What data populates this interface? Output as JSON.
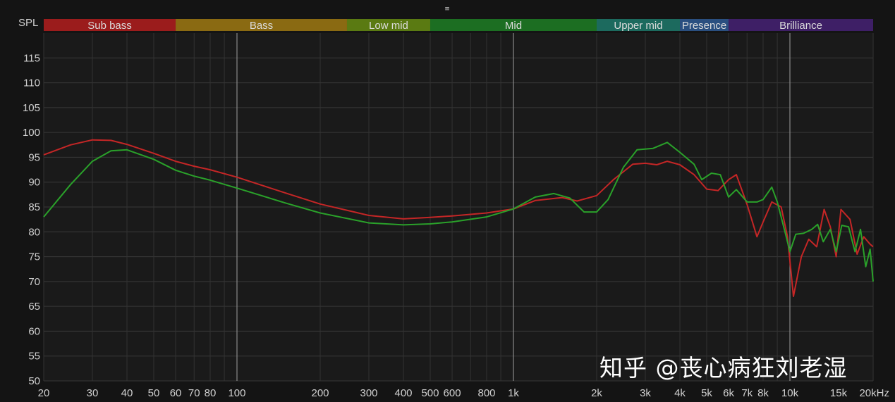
{
  "chart_data": {
    "type": "line",
    "title": "",
    "xlabel": "",
    "ylabel": "SPL",
    "x_scale": "log",
    "xlim": [
      20,
      20000
    ],
    "ylim": [
      50,
      120
    ],
    "y_ticks": [
      50,
      55,
      60,
      65,
      70,
      75,
      80,
      85,
      90,
      95,
      100,
      105,
      110,
      115
    ],
    "x_ticks": [
      {
        "v": 20,
        "label": "20"
      },
      {
        "v": 30,
        "label": "30"
      },
      {
        "v": 40,
        "label": "40"
      },
      {
        "v": 50,
        "label": "50"
      },
      {
        "v": 60,
        "label": "60"
      },
      {
        "v": 70,
        "label": "70"
      },
      {
        "v": 80,
        "label": "80"
      },
      {
        "v": 100,
        "label": "100"
      },
      {
        "v": 200,
        "label": "200"
      },
      {
        "v": 300,
        "label": "300"
      },
      {
        "v": 400,
        "label": "400"
      },
      {
        "v": 500,
        "label": "500"
      },
      {
        "v": 600,
        "label": "600"
      },
      {
        "v": 800,
        "label": "800"
      },
      {
        "v": 1000,
        "label": "1k"
      },
      {
        "v": 2000,
        "label": "2k"
      },
      {
        "v": 3000,
        "label": "3k"
      },
      {
        "v": 4000,
        "label": "4k"
      },
      {
        "v": 5000,
        "label": "5k"
      },
      {
        "v": 6000,
        "label": "6k"
      },
      {
        "v": 7000,
        "label": "7k"
      },
      {
        "v": 8000,
        "label": "8k"
      },
      {
        "v": 10000,
        "label": "10k"
      },
      {
        "v": 15000,
        "label": "15k"
      },
      {
        "v": 20000,
        "label": "20kHz"
      }
    ],
    "bands": [
      {
        "name": "Sub bass",
        "from": 20,
        "to": 60,
        "color": "#9b1c1c"
      },
      {
        "name": "Bass",
        "from": 60,
        "to": 250,
        "color": "#8a6a12"
      },
      {
        "name": "Low mid",
        "from": 250,
        "to": 500,
        "color": "#5a7a12"
      },
      {
        "name": "Mid",
        "from": 500,
        "to": 2000,
        "color": "#1c6e22"
      },
      {
        "name": "Upper mid",
        "from": 2000,
        "to": 4000,
        "color": "#1c6a5e"
      },
      {
        "name": "Presence",
        "from": 4000,
        "to": 6000,
        "color": "#2a4f80"
      },
      {
        "name": "Brilliance",
        "from": 6000,
        "to": 20000,
        "color": "#3e1f66"
      }
    ],
    "series": [
      {
        "color": "#c42626",
        "points": [
          [
            20,
            95.5
          ],
          [
            25,
            97.5
          ],
          [
            30,
            98.5
          ],
          [
            35,
            98.4
          ],
          [
            40,
            97.6
          ],
          [
            50,
            95.8
          ],
          [
            60,
            94.2
          ],
          [
            70,
            93.2
          ],
          [
            80,
            92.5
          ],
          [
            100,
            91
          ],
          [
            150,
            87.8
          ],
          [
            200,
            85.6
          ],
          [
            300,
            83.3
          ],
          [
            400,
            82.6
          ],
          [
            500,
            82.9
          ],
          [
            600,
            83.2
          ],
          [
            800,
            83.8
          ],
          [
            1000,
            84.6
          ],
          [
            1200,
            86.3
          ],
          [
            1500,
            86.9
          ],
          [
            1700,
            86.2
          ],
          [
            2000,
            87.3
          ],
          [
            2300,
            90.5
          ],
          [
            2700,
            93.6
          ],
          [
            3000,
            93.8
          ],
          [
            3300,
            93.5
          ],
          [
            3600,
            94.2
          ],
          [
            4000,
            93.5
          ],
          [
            4500,
            91.5
          ],
          [
            5000,
            88.6
          ],
          [
            5500,
            88.3
          ],
          [
            6000,
            90.5
          ],
          [
            6400,
            91.5
          ],
          [
            7000,
            85.5
          ],
          [
            7600,
            79
          ],
          [
            8000,
            82
          ],
          [
            8600,
            86
          ],
          [
            9300,
            85
          ],
          [
            9800,
            79
          ],
          [
            10300,
            67
          ],
          [
            11000,
            75
          ],
          [
            11700,
            78.5
          ],
          [
            12500,
            77
          ],
          [
            13300,
            84.5
          ],
          [
            14000,
            81
          ],
          [
            14700,
            75
          ],
          [
            15300,
            84.5
          ],
          [
            16500,
            82.5
          ],
          [
            17500,
            75.5
          ],
          [
            18500,
            79
          ],
          [
            19500,
            77.5
          ],
          [
            20000,
            77
          ]
        ]
      },
      {
        "color": "#2aa12a",
        "points": [
          [
            20,
            83
          ],
          [
            25,
            89.5
          ],
          [
            30,
            94.2
          ],
          [
            35,
            96.3
          ],
          [
            40,
            96.5
          ],
          [
            50,
            94.6
          ],
          [
            60,
            92.4
          ],
          [
            70,
            91.2
          ],
          [
            80,
            90.4
          ],
          [
            100,
            88.8
          ],
          [
            150,
            85.8
          ],
          [
            200,
            83.8
          ],
          [
            300,
            81.8
          ],
          [
            400,
            81.4
          ],
          [
            500,
            81.6
          ],
          [
            600,
            82
          ],
          [
            800,
            83
          ],
          [
            1000,
            84.6
          ],
          [
            1200,
            87
          ],
          [
            1400,
            87.7
          ],
          [
            1600,
            86.8
          ],
          [
            1800,
            84
          ],
          [
            2000,
            84
          ],
          [
            2200,
            86.5
          ],
          [
            2500,
            93
          ],
          [
            2800,
            96.5
          ],
          [
            3200,
            96.8
          ],
          [
            3600,
            98
          ],
          [
            4000,
            96
          ],
          [
            4500,
            93.6
          ],
          [
            4800,
            90.5
          ],
          [
            5200,
            91.8
          ],
          [
            5600,
            91.5
          ],
          [
            6000,
            87
          ],
          [
            6400,
            88.5
          ],
          [
            7000,
            86
          ],
          [
            7600,
            86
          ],
          [
            8000,
            86.5
          ],
          [
            8600,
            89
          ],
          [
            9000,
            86
          ],
          [
            9600,
            80
          ],
          [
            10000,
            76
          ],
          [
            10500,
            79.5
          ],
          [
            11200,
            79.7
          ],
          [
            12000,
            80.5
          ],
          [
            12600,
            81.5
          ],
          [
            13200,
            78
          ],
          [
            14000,
            80.5
          ],
          [
            14700,
            76
          ],
          [
            15400,
            81.3
          ],
          [
            16300,
            81
          ],
          [
            17200,
            76
          ],
          [
            18000,
            80.5
          ],
          [
            18800,
            73
          ],
          [
            19500,
            76.5
          ],
          [
            20000,
            70
          ]
        ]
      }
    ]
  },
  "watermark": "知乎 @丧心病狂刘老湿",
  "top_icon": "≡"
}
